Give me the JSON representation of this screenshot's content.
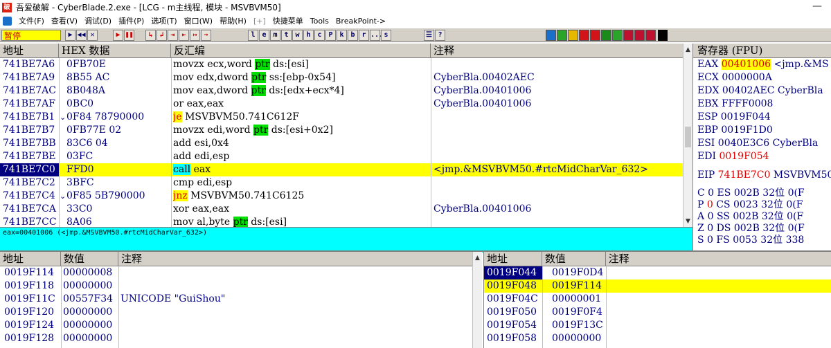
{
  "window": {
    "title": "吾爱破解 - CyberBlade.2.exe - [LCG - m主线程, 模块 - MSVBVM50]",
    "app_icon_text": "破",
    "minimize": "—"
  },
  "menu": {
    "items": [
      "文件(F)",
      "查看(V)",
      "调试(D)",
      "插件(P)",
      "选项(T)",
      "窗口(W)",
      "帮助(H)",
      "[+]",
      "快捷菜单",
      "Tools",
      "BreakPoint->"
    ]
  },
  "toolbar": {
    "status": "暂停",
    "buttons_a": [
      "▶",
      "◀◀",
      "✕"
    ],
    "buttons_b": [
      "▶",
      "❚❚"
    ],
    "buttons_c": [
      "↳",
      "↲",
      "⇥",
      "⇤",
      "↦",
      "⇒"
    ],
    "letter_buttons": [
      "l",
      "e",
      "m",
      "t",
      "w",
      "h",
      "c",
      "P",
      "k",
      "b",
      "r",
      "...",
      "s"
    ],
    "buttons_d": [
      "☰",
      "?"
    ],
    "plugin_colors": [
      "#1a6fc9",
      "#2aa52a",
      "#e6b800",
      "#d2141a",
      "#d2141a",
      "#1a8a1a",
      "#2aa52a",
      "#c01030",
      "#c01030",
      "#c01030"
    ]
  },
  "cpu": {
    "headers": [
      "地址",
      "HEX 数据",
      "反汇编",
      "注释"
    ],
    "rows": [
      {
        "addr": "741BE7A6",
        "mark": "",
        "hex": "0FB70E",
        "pre": "movzx ecx,word ",
        "ptr": "ptr",
        "post": " ds:[esi]",
        "comment": ""
      },
      {
        "addr": "741BE7A9",
        "mark": "",
        "hex": "8B55 AC",
        "pre": "mov edx,dword ",
        "ptr": "ptr",
        "post": " ss:[ebp-0x54]",
        "comment": "CyberBla.00402AEC"
      },
      {
        "addr": "741BE7AC",
        "mark": "",
        "hex": "8B048A",
        "pre": "mov eax,dword ",
        "ptr": "ptr",
        "post": " ds:[edx+ecx*4]",
        "comment": "CyberBla.00401006"
      },
      {
        "addr": "741BE7AF",
        "mark": "",
        "hex": "0BC0",
        "pre": "or eax,eax",
        "ptr": "",
        "post": "",
        "comment": "CyberBla.00401006"
      },
      {
        "addr": "741BE7B1",
        "mark": "⌄",
        "hex": "0F84 78790000",
        "jmp": "je",
        "pre": " MSVBVM50.741C612F",
        "ptr": "",
        "post": "",
        "comment": ""
      },
      {
        "addr": "741BE7B7",
        "mark": "",
        "hex": "0FB77E 02",
        "pre": "movzx edi,word ",
        "ptr": "ptr",
        "post": " ds:[esi+0x2]",
        "comment": ""
      },
      {
        "addr": "741BE7BB",
        "mark": "",
        "hex": "83C6 04",
        "pre": "add esi,0x4",
        "ptr": "",
        "post": "",
        "comment": ""
      },
      {
        "addr": "741BE7BE",
        "mark": "",
        "hex": "03FC",
        "pre": "add edi,esp",
        "ptr": "",
        "post": "",
        "comment": ""
      },
      {
        "addr": "741BE7C0",
        "mark": "",
        "hex": "FFD0",
        "call": "call",
        "pre": " eax",
        "ptr": "",
        "post": "",
        "comment": "<jmp.&MSVBVM50.#rtcMidCharVar_632>",
        "selected": true
      },
      {
        "addr": "741BE7C2",
        "mark": "",
        "hex": "3BFC",
        "pre": "cmp edi,esp",
        "ptr": "",
        "post": "",
        "comment": ""
      },
      {
        "addr": "741BE7C4",
        "mark": "⌄",
        "hex": "0F85 5B790000",
        "jmp": "jnz",
        "pre": " MSVBVM50.741C6125",
        "ptr": "",
        "post": "",
        "comment": ""
      },
      {
        "addr": "741BE7CA",
        "mark": "",
        "hex": "33C0",
        "pre": "xor eax,eax",
        "ptr": "",
        "post": "",
        "comment": "CyberBla.00401006"
      },
      {
        "addr": "741BE7CC",
        "mark": "",
        "hex": "8A06",
        "pre": "mov al,byte ",
        "ptr": "ptr",
        "post": " ds:[esi]",
        "comment": ""
      }
    ]
  },
  "info_line": "eax=00401006 (<jmp.&MSVBVM50.#rtcMidCharVar_632>)",
  "registers": {
    "header": "寄存器 (FPU)",
    "lines": [
      {
        "name": "EAX",
        "value": "00401006",
        "rest": " <jmp.&MS",
        "hl": true,
        "red": false
      },
      {
        "name": "ECX",
        "value": "0000000A",
        "rest": "",
        "hl": false,
        "red": false
      },
      {
        "name": "EDX",
        "value": "00402AEC",
        "rest": " CyberBla",
        "hl": false,
        "red": false
      },
      {
        "name": "EBX",
        "value": "FFFF0008",
        "rest": "",
        "hl": false,
        "red": false
      },
      {
        "name": "ESP",
        "value": "0019F044",
        "rest": "",
        "hl": false,
        "red": false
      },
      {
        "name": "EBP",
        "value": "0019F1D0",
        "rest": "",
        "hl": false,
        "red": false
      },
      {
        "name": "ESI",
        "value": "0040E3C6",
        "rest": " CyberBla",
        "hl": false,
        "red": false
      },
      {
        "name": "EDI",
        "value": "0019F054",
        "rest": "",
        "hl": false,
        "red": true
      }
    ],
    "eip": {
      "name": "EIP",
      "value": "741BE7C0",
      "rest": " MSVBVM50"
    },
    "flags": [
      {
        "flag": "C",
        "val": "0",
        "seg": "ES",
        "sel": "002B",
        "bits": "32位",
        "tail": "0(F",
        "red": false
      },
      {
        "flag": "P",
        "val": "0",
        "seg": "CS",
        "sel": "0023",
        "bits": "32位",
        "tail": "0(F",
        "red": true
      },
      {
        "flag": "A",
        "val": "0",
        "seg": "SS",
        "sel": "002B",
        "bits": "32位",
        "tail": "0(F",
        "red": false
      },
      {
        "flag": "Z",
        "val": "0",
        "seg": "DS",
        "sel": "002B",
        "bits": "32位",
        "tail": "0(F",
        "red": false
      },
      {
        "flag": "S",
        "val": "0",
        "seg": "FS",
        "sel": "0053",
        "bits": "32位",
        "tail": "338",
        "red": false
      }
    ]
  },
  "dump": {
    "headers": [
      "地址",
      "数值",
      "注释"
    ],
    "rows": [
      {
        "addr": "0019F114",
        "value": "00000008",
        "comment": ""
      },
      {
        "addr": "0019F118",
        "value": "00000000",
        "comment": ""
      },
      {
        "addr": "0019F11C",
        "value": "00557F34",
        "comment": "UNICODE \"GuiShou\""
      },
      {
        "addr": "0019F120",
        "value": "00000000",
        "comment": ""
      },
      {
        "addr": "0019F124",
        "value": "00000000",
        "comment": ""
      },
      {
        "addr": "0019F128",
        "value": "00000000",
        "comment": ""
      }
    ]
  },
  "stack": {
    "headers": [
      "地址",
      "数值",
      "注释"
    ],
    "rows": [
      {
        "addr": "0019F044",
        "value": "0019F0D4",
        "comment": "",
        "selected": false,
        "cur": true
      },
      {
        "addr": "0019F048",
        "value": "0019F114",
        "comment": "",
        "selected": true,
        "cur": false
      },
      {
        "addr": "0019F04C",
        "value": "00000001",
        "comment": "",
        "selected": false,
        "cur": false
      },
      {
        "addr": "0019F050",
        "value": "0019F0F4",
        "comment": "",
        "selected": false,
        "cur": false
      },
      {
        "addr": "0019F054",
        "value": "0019F13C",
        "comment": "",
        "selected": false,
        "cur": false
      },
      {
        "addr": "0019F058",
        "value": "00000000",
        "comment": "",
        "selected": false,
        "cur": false
      }
    ]
  }
}
